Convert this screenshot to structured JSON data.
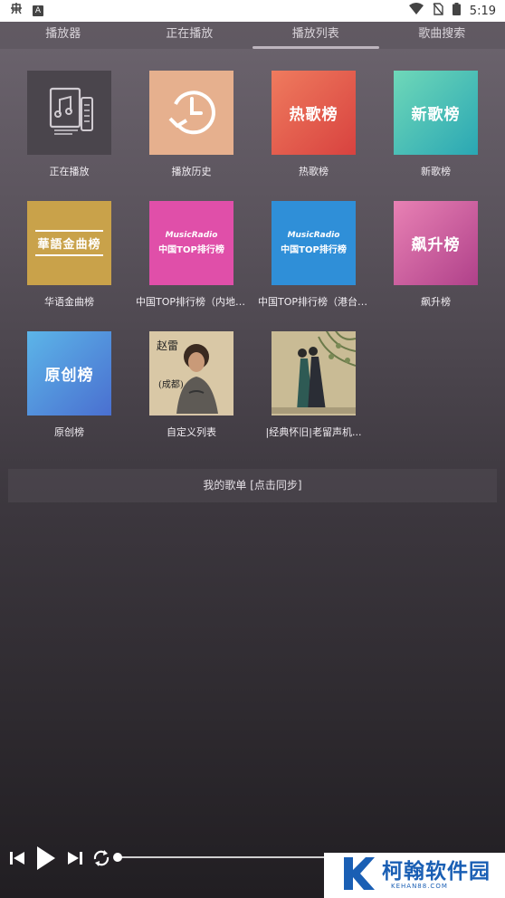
{
  "statusbar": {
    "time": "5:19",
    "left_icons": [
      "bug-icon",
      "a-badge-icon"
    ],
    "right_icons": [
      "wifi-icon",
      "no-sim-icon",
      "battery-icon"
    ]
  },
  "tabs": [
    {
      "label": "播放器",
      "active": false
    },
    {
      "label": "正在播放",
      "active": false
    },
    {
      "label": "播放列表",
      "active": true
    },
    {
      "label": "歌曲搜索",
      "active": false
    }
  ],
  "grid": {
    "items": [
      {
        "label": "正在播放",
        "cover": "now-playing-icon"
      },
      {
        "label": "播放历史",
        "cover": "history-clock-icon"
      },
      {
        "label": "热歌榜",
        "cover_text": "热歌榜"
      },
      {
        "label": "新歌榜",
        "cover_text": "新歌榜"
      },
      {
        "label": "华语金曲榜",
        "cover_text": "華語金曲榜"
      },
      {
        "label": "中国TOP排行榜（内地榜）",
        "cover_title": "MusicRadio",
        "cover_sub": "中国TOP排行榜"
      },
      {
        "label": "中国TOP排行榜（港台榜）",
        "cover_title": "MusicRadio",
        "cover_sub": "中国TOP排行榜"
      },
      {
        "label": "飙升榜",
        "cover_text": "飙升榜"
      },
      {
        "label": "原创榜",
        "cover_text": "原创榜"
      },
      {
        "label": "自定义列表",
        "cover": "album-art-photo"
      },
      {
        "label": "|经典怀旧|老留声机...",
        "cover": "album-art-painting"
      }
    ]
  },
  "playlist_bar": {
    "label": "我的歌单 [点击同步]"
  },
  "player": {
    "controls": [
      "previous-icon",
      "play-icon",
      "next-icon",
      "repeat-icon"
    ],
    "progress": 0
  },
  "watermark": {
    "text": "柯翰软件园",
    "sub": "KEHAN88.COM"
  },
  "colors": {
    "hot": "#e0564a",
    "new": "#3ec0b0",
    "chinese": "#c9a24a",
    "top_mainland": "#e04fa9",
    "top_hk": "#2f8fd8",
    "rising": "#c24f95",
    "original": "#4a88d8"
  }
}
